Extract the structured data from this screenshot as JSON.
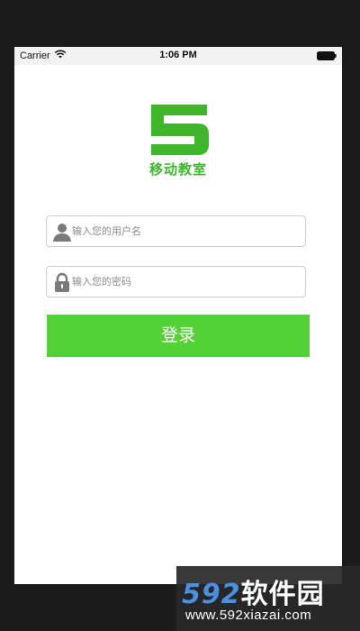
{
  "status_bar": {
    "carrier": "Carrier",
    "time": "1:06 PM",
    "wifi_icon": "wifi-icon",
    "battery_icon": "battery-icon"
  },
  "app": {
    "logo_icon": "logo-5-icon",
    "title": "移动教室",
    "brand_color": "#3fb52c"
  },
  "login_form": {
    "username": {
      "icon": "user-icon",
      "placeholder": "输入您的用户名",
      "value": ""
    },
    "password": {
      "icon": "lock-icon",
      "placeholder": "输入您的密码",
      "value": ""
    },
    "submit_label": "登录",
    "button_color": "#55d138"
  },
  "watermark": {
    "brand_number": "592",
    "brand_text": "软件园",
    "url": "www.592xiazai.com"
  }
}
